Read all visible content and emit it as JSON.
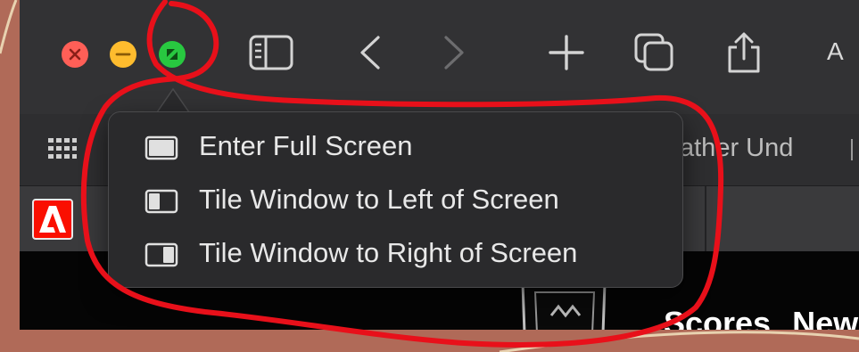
{
  "toolbar": {
    "trailing_text": "A"
  },
  "favorites_bar": {
    "partial_item": "ather Und"
  },
  "page": {
    "nav_items": [
      "Scores",
      "New"
    ]
  },
  "zoom_menu": {
    "items": [
      {
        "label": "Enter Full Screen",
        "icon": "full-screen-icon"
      },
      {
        "label": "Tile Window to Left of Screen",
        "icon": "tile-left-icon"
      },
      {
        "label": "Tile Window to Right of Screen",
        "icon": "tile-right-icon"
      }
    ]
  },
  "colors": {
    "close": "#ff5f57",
    "minimize": "#febc2e",
    "zoom": "#28c840",
    "annotation": "#e8101a",
    "desktop": "#b06a58"
  }
}
